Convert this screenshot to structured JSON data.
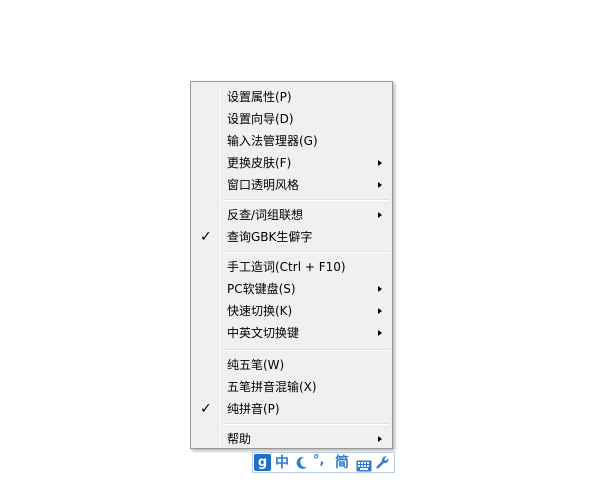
{
  "menu": {
    "items": [
      {
        "label": "设置属性(P)",
        "submenu": false,
        "checked": false
      },
      {
        "label": "设置向导(D)",
        "submenu": false,
        "checked": false
      },
      {
        "label": "输入法管理器(G)",
        "submenu": false,
        "checked": false
      },
      {
        "label": "更换皮肤(F)",
        "submenu": true,
        "checked": false
      },
      {
        "label": "窗口透明风格",
        "submenu": true,
        "checked": false
      },
      {
        "label": "反查/词组联想",
        "submenu": true,
        "checked": false
      },
      {
        "label": "查询GBK生僻字",
        "submenu": false,
        "checked": true
      },
      {
        "label": "手工造词(Ctrl + F10)",
        "submenu": false,
        "checked": false
      },
      {
        "label": "PC软键盘(S)",
        "submenu": true,
        "checked": false
      },
      {
        "label": "快速切换(K)",
        "submenu": true,
        "checked": false
      },
      {
        "label": "中英文切换键",
        "submenu": true,
        "checked": false
      },
      {
        "label": "纯五笔(W)",
        "submenu": false,
        "checked": false
      },
      {
        "label": "五笔拼音混输(X)",
        "submenu": false,
        "checked": false
      },
      {
        "label": "纯拼音(P)",
        "submenu": false,
        "checked": true
      },
      {
        "label": "帮助",
        "submenu": true,
        "checked": false
      }
    ],
    "check_glyph": "✓"
  },
  "imebar": {
    "logo": "g",
    "mode": "中",
    "punct": "°,",
    "charset": "简",
    "icons": [
      "ime-logo-icon",
      "half-moon-icon",
      "punctuation-icon",
      "keyboard-icon",
      "wrench-icon"
    ],
    "accent_color": "#2f7bd1"
  }
}
